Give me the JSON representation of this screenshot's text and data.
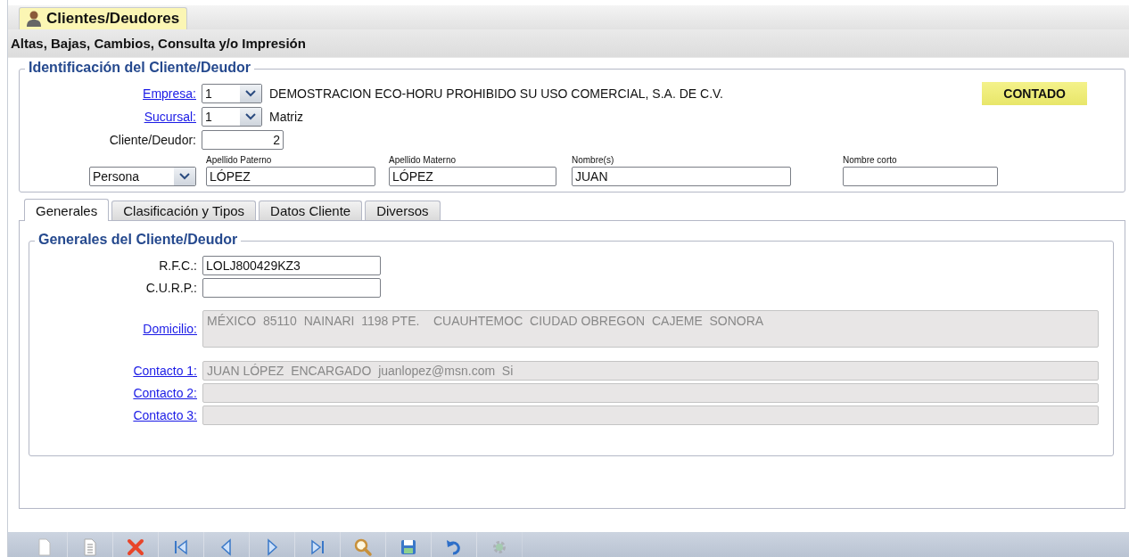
{
  "main_tab": {
    "label": "Clientes/Deudores",
    "selected": true
  },
  "subtitle": "Altas, Bajas, Cambios, Consulta y/o Impresión",
  "identification": {
    "legend": "Identificación del Cliente/Deudor",
    "empresa": {
      "label": "Empresa:",
      "value": "1",
      "description": "DEMOSTRACION ECO-HORU PROHIBIDO SU USO COMERCIAL, S.A. DE C.V."
    },
    "sucursal": {
      "label": "Sucursal:",
      "value": "1",
      "description": "Matriz"
    },
    "cliente": {
      "label": "Cliente/Deudor:",
      "value": "2"
    },
    "badge": "CONTADO",
    "person_type": "Persona",
    "name_fields": [
      {
        "label": "Apellido Paterno",
        "value": "LÓPEZ"
      },
      {
        "label": "Apellido Materno",
        "value": "LÓPEZ"
      },
      {
        "label": "Nombre(s)",
        "value": "JUAN"
      },
      {
        "label": "Nombre corto"
      }
    ]
  },
  "tabs": [
    {
      "label": "Generales",
      "selected": true
    },
    {
      "label": "Clasificación y Tipos",
      "selected": false
    },
    {
      "label": "Datos Cliente",
      "selected": false
    },
    {
      "label": "Diversos",
      "selected": false
    }
  ],
  "generales": {
    "legend": "Generales del Cliente/Deudor",
    "rfc": {
      "label": "R.F.C.:",
      "value": "LOLJ800429KZ3"
    },
    "curp": {
      "label": "C.U.R.P.:"
    },
    "domicilio": {
      "label": "Domicilio:",
      "value": "MÉXICO  85110  NAINARI  1198 PTE.    CUAUHTEMOC  CIUDAD OBREGON  CAJEME  SONORA"
    },
    "contacts": [
      {
        "label": "Contacto 1:",
        "value": "JUAN LÓPEZ  ENCARGADO  juanlopez@msn.com  Si"
      },
      {
        "label": "Contacto 2:"
      },
      {
        "label": "Contacto 3:"
      }
    ]
  },
  "toolbar": [
    {
      "kind": "new",
      "disabled": false
    },
    {
      "kind": "document",
      "disabled": false
    },
    {
      "kind": "delete",
      "disabled": false
    },
    {
      "kind": "first",
      "disabled": false
    },
    {
      "kind": "prev",
      "disabled": false
    },
    {
      "kind": "next",
      "disabled": false
    },
    {
      "kind": "last",
      "disabled": false
    },
    {
      "kind": "search",
      "disabled": false
    },
    {
      "kind": "save",
      "disabled": false
    },
    {
      "kind": "undo",
      "disabled": false
    },
    {
      "kind": "gear",
      "disabled": true
    }
  ]
}
